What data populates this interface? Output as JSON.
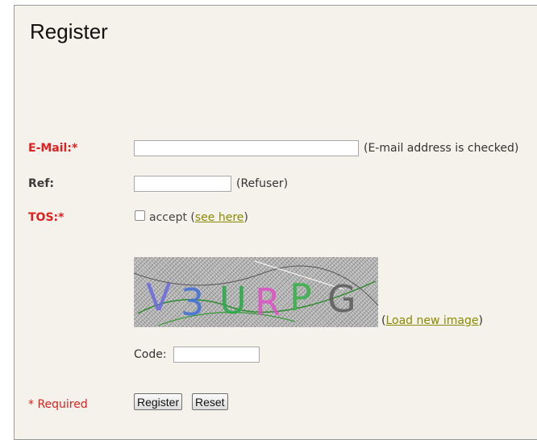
{
  "title": "Register",
  "fields": {
    "email": {
      "label": "E-Mail:*",
      "value": "",
      "hint": "(E-mail address is checked)"
    },
    "ref": {
      "label": "Ref:",
      "value": "",
      "hint": "(Refuser)"
    },
    "tos": {
      "label": "TOS:*",
      "accept_text": "accept (",
      "link_text": "see here",
      "close_paren": ")"
    }
  },
  "captcha": {
    "image_text": "V3URPG",
    "reload_open": "(",
    "reload_link": "Load new image",
    "reload_close": ")",
    "code_label": "Code:",
    "code_value": ""
  },
  "footer": {
    "required_note": "* Required",
    "register_label": "Register",
    "reset_label": "Reset"
  },
  "colors": {
    "panel_bg": "#f5f2eb",
    "required_red": "#e0201f",
    "link_olive": "#8a8a00"
  }
}
